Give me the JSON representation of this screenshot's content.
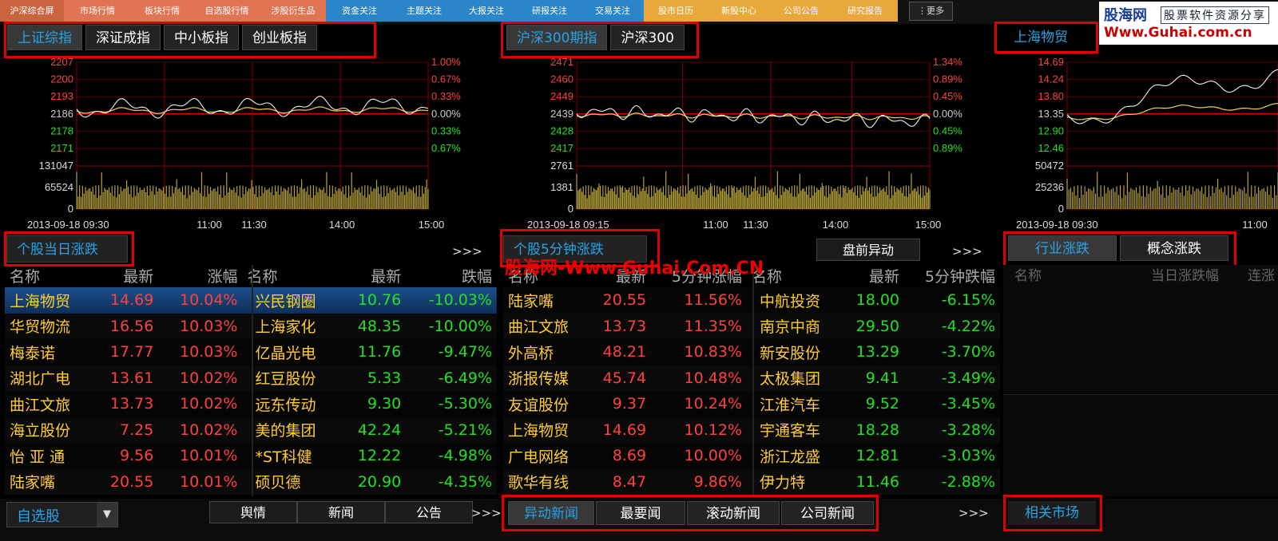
{
  "nav": [
    {
      "label": "沪深综合屏",
      "color": "#c9643f"
    },
    {
      "label": "市场行情",
      "color": "#e17452"
    },
    {
      "label": "板块行情",
      "color": "#e17452"
    },
    {
      "label": "自选股行情",
      "color": "#e17452"
    },
    {
      "label": "涉股衍生品",
      "color": "#e17452"
    },
    {
      "label": "资金关注",
      "color": "#2a86c8"
    },
    {
      "label": "主题关注",
      "color": "#2a86c8"
    },
    {
      "label": "大报关注",
      "color": "#2a86c8"
    },
    {
      "label": "研报关注",
      "color": "#2a86c8"
    },
    {
      "label": "交易关注",
      "color": "#2a86c8"
    },
    {
      "label": "股市日历",
      "color": "#e8a93a"
    },
    {
      "label": "新股中心",
      "color": "#e8a93a"
    },
    {
      "label": "公司公告",
      "color": "#e8a93a"
    },
    {
      "label": "研究报告",
      "color": "#e8a93a"
    }
  ],
  "more_label": "⋮更多",
  "brand": {
    "name": "股海网",
    "slogan": "股票软件资源分享",
    "url": "Www.Guhai.com.cn"
  },
  "watermark": "股海网-Www.Guhai.Com.CN",
  "chart1": {
    "tabs": [
      "上证综指",
      "深证成指",
      "中小板指",
      "创业板指"
    ],
    "price_ticks": [
      "2207",
      "2200",
      "2193",
      "2186",
      "2178",
      "2171"
    ],
    "pct_ticks": [
      "1.00%",
      "0.67%",
      "0.33%",
      "0.00%",
      "0.33%",
      "0.67%"
    ],
    "vol_ticks": [
      "131047",
      "65524",
      "0"
    ],
    "time_labels": [
      "2013-09-18 09:30",
      "11:00",
      "11:30",
      "14:00",
      "15:00"
    ]
  },
  "chart2": {
    "tabs": [
      "沪深300期指",
      "沪深300"
    ],
    "price_ticks": [
      "2471",
      "2460",
      "2449",
      "2439",
      "2428",
      "2417"
    ],
    "pct_ticks": [
      "1.34%",
      "0.89%",
      "0.45%",
      "0.00%",
      "0.45%",
      "0.89%"
    ],
    "vol_ticks": [
      "2761",
      "1381",
      "0"
    ],
    "time_labels": [
      "2013-09-18 09:15",
      "11:00",
      "11:30",
      "14:00",
      "15:00"
    ]
  },
  "chart3": {
    "tabs": [
      "上海物贸"
    ],
    "price_ticks": [
      "14.69",
      "14.24",
      "13.80",
      "13.35",
      "12.90",
      "12.46"
    ],
    "vol_ticks": [
      "50472",
      "25236",
      "0"
    ],
    "time_labels": [
      "2013-09-18 09:30",
      "11:00"
    ]
  },
  "panel1": {
    "title": "个股当日涨跌",
    "arrows": ">>>",
    "headers": [
      "名称",
      "最新",
      "涨幅",
      "名称",
      "最新",
      "跌幅"
    ],
    "left_rows": [
      [
        "上海物贸",
        "14.69",
        "10.04%"
      ],
      [
        "华贸物流",
        "16.56",
        "10.03%"
      ],
      [
        "梅泰诺",
        "17.77",
        "10.03%"
      ],
      [
        "湖北广电",
        "13.61",
        "10.02%"
      ],
      [
        "曲江文旅",
        "13.73",
        "10.02%"
      ],
      [
        "海立股份",
        "7.25",
        "10.02%"
      ],
      [
        "怡 亚 通",
        "9.56",
        "10.01%"
      ],
      [
        "陆家嘴",
        "20.55",
        "10.01%"
      ]
    ],
    "right_rows": [
      [
        "兴民钢圈",
        "10.76",
        "-10.03%"
      ],
      [
        "上海家化",
        "48.35",
        "-10.00%"
      ],
      [
        "亿晶光电",
        "11.76",
        "-9.47%"
      ],
      [
        "红豆股份",
        "5.33",
        "-6.49%"
      ],
      [
        "远东传动",
        "9.30",
        "-5.30%"
      ],
      [
        "美的集团",
        "42.24",
        "-5.21%"
      ],
      [
        "*ST科健",
        "12.22",
        "-4.98%"
      ],
      [
        "硕贝德",
        "20.90",
        "-4.35%"
      ]
    ]
  },
  "panel2": {
    "title": "个股5分钟涨跌",
    "button": "盘前异动",
    "arrows": ">>>",
    "headers": [
      "名称",
      "最新",
      "5分钟涨幅",
      "名称",
      "最新",
      "5分钟跌幅"
    ],
    "left_rows": [
      [
        "陆家嘴",
        "20.55",
        "11.56%"
      ],
      [
        "曲江文旅",
        "13.73",
        "11.35%"
      ],
      [
        "外高桥",
        "48.21",
        "10.83%"
      ],
      [
        "浙报传媒",
        "45.74",
        "10.48%"
      ],
      [
        "友谊股份",
        "9.37",
        "10.24%"
      ],
      [
        "上海物贸",
        "14.69",
        "10.12%"
      ],
      [
        "广电网络",
        "8.69",
        "10.00%"
      ],
      [
        "歌华有线",
        "8.47",
        "9.86%"
      ]
    ],
    "right_rows": [
      [
        "中航投资",
        "18.00",
        "-6.15%"
      ],
      [
        "南京中商",
        "29.50",
        "-4.22%"
      ],
      [
        "新安股份",
        "13.29",
        "-3.70%"
      ],
      [
        "太极集团",
        "9.41",
        "-3.49%"
      ],
      [
        "江淮汽车",
        "9.52",
        "-3.45%"
      ],
      [
        "宇通客车",
        "18.28",
        "-3.28%"
      ],
      [
        "浙江龙盛",
        "12.81",
        "-3.03%"
      ],
      [
        "伊力特",
        "11.46",
        "-2.88%"
      ]
    ]
  },
  "panel3": {
    "tabs": [
      "行业涨跌",
      "概念涨跌"
    ],
    "headers": [
      "名称",
      "当日涨跌幅",
      "连涨"
    ]
  },
  "bottom": {
    "watchlist": "自选股",
    "dropdown": "▼",
    "news_tabs_left": [
      "舆情",
      "新闻",
      "公告"
    ],
    "arrows": ">>>",
    "news_tabs_mid": [
      "异动新闻",
      "最要闻",
      "滚动新闻",
      "公司新闻"
    ],
    "arrows2": ">>>",
    "related": "相关市场"
  }
}
